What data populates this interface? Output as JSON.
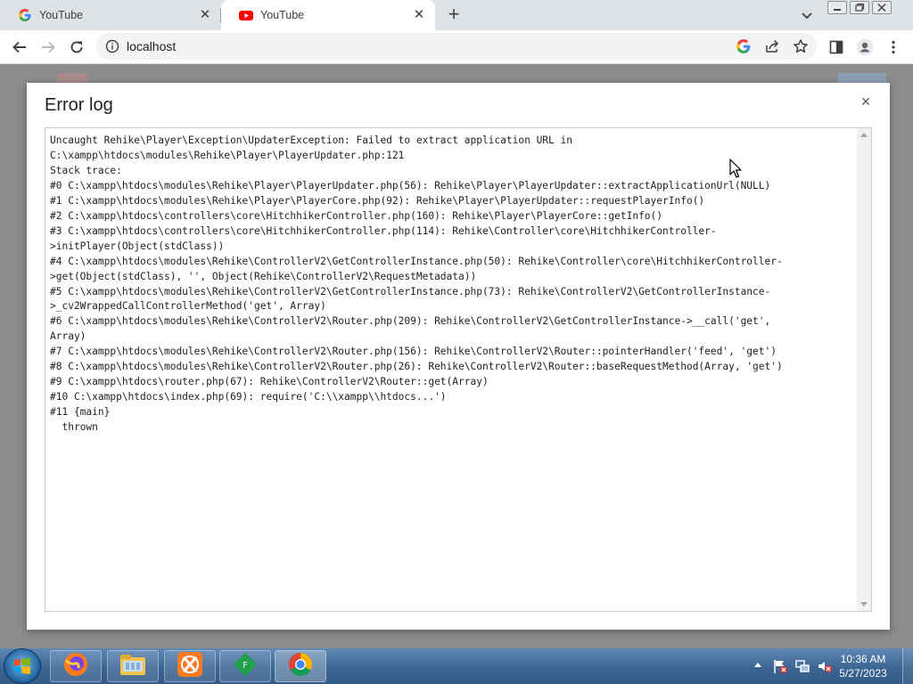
{
  "browser": {
    "tabs": [
      {
        "title": "YouTube",
        "favicon": "google-icon",
        "active": false
      },
      {
        "title": "YouTube",
        "favicon": "youtube-icon",
        "active": true
      }
    ],
    "address": "localhost",
    "icons": [
      "back-icon",
      "forward-icon",
      "reload-icon",
      "info-icon",
      "google-lens-icon",
      "share-icon",
      "star-icon",
      "side-panel-icon",
      "profile-icon",
      "menu-icon"
    ]
  },
  "modal": {
    "title": "Error log",
    "close_label": "×",
    "log_text": "Uncaught Rehike\\Player\\Exception\\UpdaterException: Failed to extract application URL in\nC:\\xampp\\htdocs\\modules\\Rehike\\Player\\PlayerUpdater.php:121\nStack trace:\n#0 C:\\xampp\\htdocs\\modules\\Rehike\\Player\\PlayerUpdater.php(56): Rehike\\Player\\PlayerUpdater::extractApplicationUrl(NULL)\n#1 C:\\xampp\\htdocs\\modules\\Rehike\\Player\\PlayerCore.php(92): Rehike\\Player\\PlayerUpdater::requestPlayerInfo()\n#2 C:\\xampp\\htdocs\\controllers\\core\\HitchhikerController.php(160): Rehike\\Player\\PlayerCore::getInfo()\n#3 C:\\xampp\\htdocs\\controllers\\core\\HitchhikerController.php(114): Rehike\\Controller\\core\\HitchhikerController-\n>initPlayer(Object(stdClass))\n#4 C:\\xampp\\htdocs\\modules\\Rehike\\ControllerV2\\GetControllerInstance.php(50): Rehike\\Controller\\core\\HitchhikerController-\n>get(Object(stdClass), '', Object(Rehike\\ControllerV2\\RequestMetadata))\n#5 C:\\xampp\\htdocs\\modules\\Rehike\\ControllerV2\\GetControllerInstance.php(73): Rehike\\ControllerV2\\GetControllerInstance-\n>_cv2WrappedCallControllerMethod('get', Array)\n#6 C:\\xampp\\htdocs\\modules\\Rehike\\ControllerV2\\Router.php(209): Rehike\\ControllerV2\\GetControllerInstance->__call('get',\nArray)\n#7 C:\\xampp\\htdocs\\modules\\Rehike\\ControllerV2\\Router.php(156): Rehike\\ControllerV2\\Router::pointerHandler('feed', 'get')\n#8 C:\\xampp\\htdocs\\modules\\Rehike\\ControllerV2\\Router.php(26): Rehike\\ControllerV2\\Router::baseRequestMethod(Array, 'get')\n#9 C:\\xampp\\htdocs\\router.php(67): Rehike\\ControllerV2\\Router::get(Array)\n#10 C:\\xampp\\htdocs\\index.php(69): require('C:\\\\xampp\\\\htdocs...')\n#11 {main}\n  thrown"
  },
  "taskbar": {
    "apps": [
      "firefox-icon",
      "file-explorer-icon",
      "xampp-icon",
      "green-app-icon",
      "chrome-icon"
    ],
    "tray_icons": [
      "flag-icon",
      "network-icon",
      "volume-muted-icon"
    ],
    "time": "10:36 AM",
    "date": "5/27/2023"
  },
  "colors": {
    "tab_strip": "#dee1e6",
    "page_dim": "#8c8c8c",
    "youtube_red": "#ff0000",
    "taskbar": "#3c6593"
  }
}
